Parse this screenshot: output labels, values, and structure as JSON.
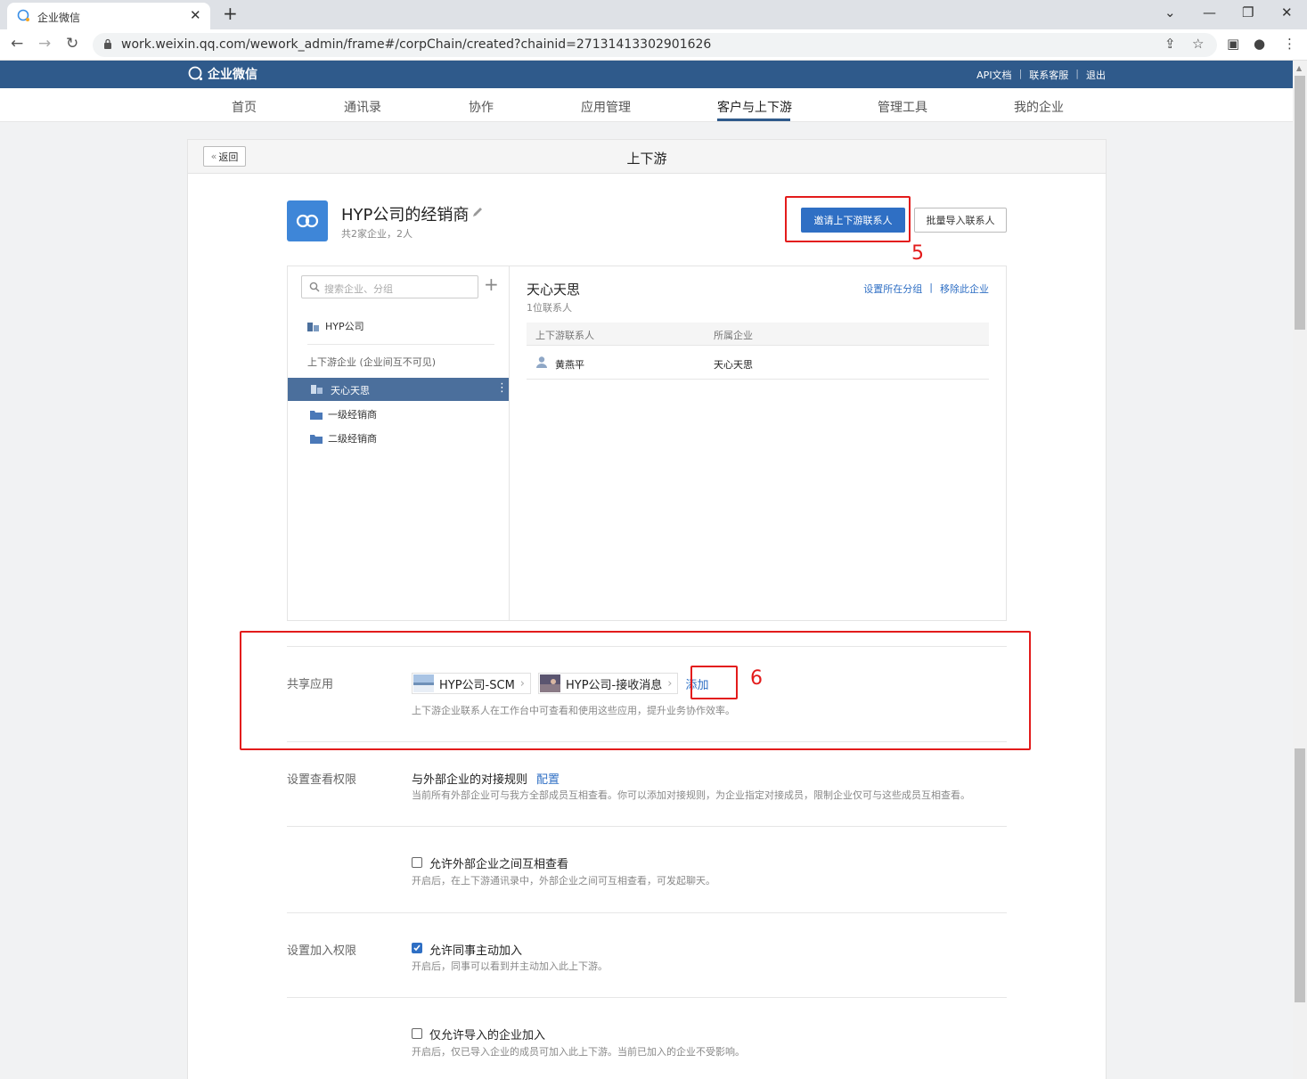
{
  "browser": {
    "tab_title": "企业微信",
    "url": "work.weixin.qq.com/wework_admin/frame#/corpChain/created?chainid=27131413302901626"
  },
  "header": {
    "logo_text": "企业微信",
    "links": [
      "API文档",
      "联系客服",
      "退出"
    ]
  },
  "nav": {
    "items": [
      "首页",
      "通讯录",
      "协作",
      "应用管理",
      "客户与上下游",
      "管理工具",
      "我的企业"
    ],
    "active": "客户与上下游"
  },
  "page": {
    "back_label": "返回",
    "title": "上下游"
  },
  "chain": {
    "name": "HYP公司的经销商",
    "summary": "共2家企业，2人",
    "invite_button": "邀请上下游联系人",
    "import_button": "批量导入联系人"
  },
  "annotations": {
    "step5": "5",
    "step6": "6"
  },
  "sidebar": {
    "search_placeholder": "搜索企业、分组",
    "own_corp": "HYP公司",
    "chain_label": "上下游企业 (企业间互不可见)",
    "selected_corp": "天心天思",
    "groups": [
      "一级经销商",
      "二级经销商"
    ]
  },
  "detail": {
    "corp_name": "天心天思",
    "contact_count": "1位联系人",
    "action_group": "设置所在分组",
    "action_remove": "移除此企业",
    "columns": [
      "上下游联系人",
      "所属企业"
    ],
    "rows": [
      {
        "contact": "黄燕平",
        "corp": "天心天思"
      }
    ]
  },
  "shared_apps": {
    "label": "共享应用",
    "apps": [
      "HYP公司-SCM",
      "HYP公司-接收消息"
    ],
    "add_label": "添加",
    "desc": "上下游企业联系人在工作台中可查看和使用这些应用，提升业务协作效率。"
  },
  "view_permission": {
    "label": "设置查看权限",
    "rule_title": "与外部企业的对接规则",
    "rule_link": "配置",
    "rule_desc": "当前所有外部企业可与我方全部成员互相查看。你可以添加对接规则，为企业指定对接成员，限制企业仅可与这些成员互相查看。",
    "mutual_label": "允许外部企业之间互相查看",
    "mutual_checked": false,
    "mutual_desc": "开启后，在上下游通讯录中，外部企业之间可互相查看，可发起聊天。"
  },
  "join_permission": {
    "label": "设置加入权限",
    "colleague_label": "允许同事主动加入",
    "colleague_checked": true,
    "colleague_desc": "开启后，同事可以看到并主动加入此上下游。",
    "imported_label": "仅允许导入的企业加入",
    "imported_checked": false,
    "imported_desc": "开启后，仅已导入企业的成员可加入此上下游。当前已加入的企业不受影响。"
  },
  "colors": {
    "header_bg": "#2f5a8b",
    "primary": "#2f6fc4",
    "selected_row": "#4b6f9c",
    "annotation_red": "#e31b1b"
  }
}
